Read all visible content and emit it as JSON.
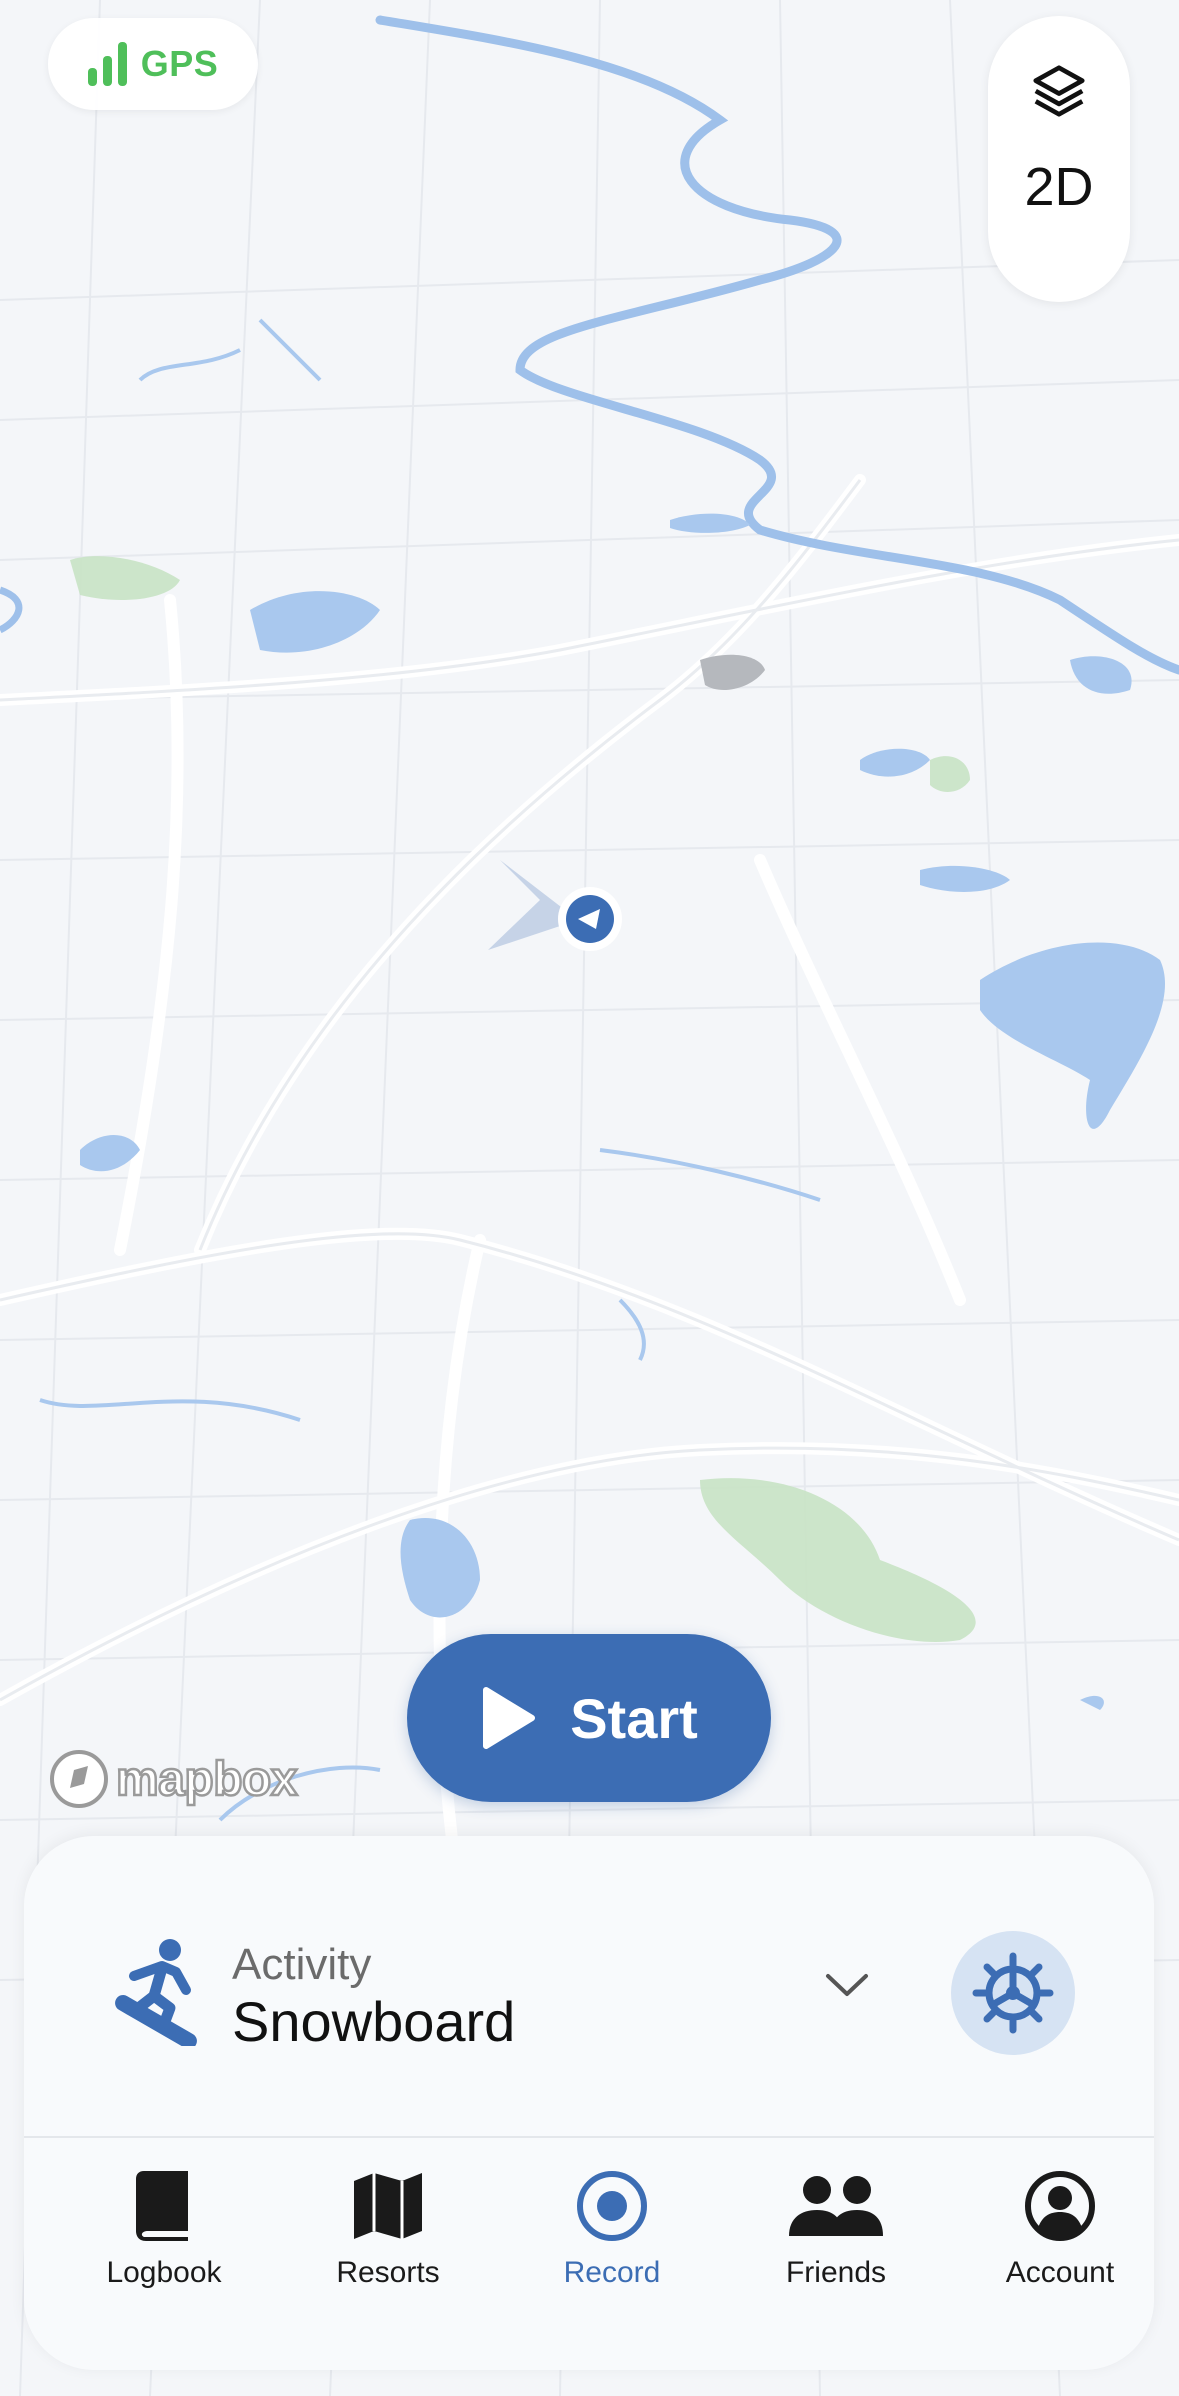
{
  "status": {
    "gps_label": "GPS",
    "gps_color": "#4fbf5a"
  },
  "map_controls": {
    "layers_icon": "layers-icon",
    "view_mode": "2D"
  },
  "record": {
    "start_label": "Start",
    "start_icon": "play-icon",
    "accent_color": "#3c6db4"
  },
  "attribution": {
    "logo_text": "mapbox"
  },
  "activity": {
    "caption": "Activity",
    "value": "Snowboard",
    "icon": "snowboarder-icon",
    "dropdown_icon": "chevron-down-icon",
    "settings_icon": "gear-icon"
  },
  "tabs": [
    {
      "label": "Logbook",
      "icon": "book-icon",
      "active": false
    },
    {
      "label": "Resorts",
      "icon": "map-icon",
      "active": false
    },
    {
      "label": "Record",
      "icon": "record-icon",
      "active": true
    },
    {
      "label": "Friends",
      "icon": "friends-icon",
      "active": false
    },
    {
      "label": "Account",
      "icon": "account-icon",
      "active": false
    }
  ]
}
